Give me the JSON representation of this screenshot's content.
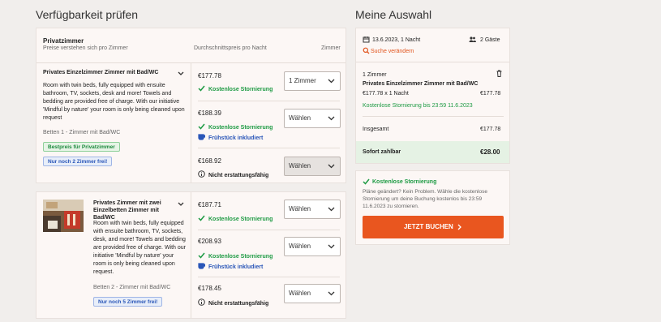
{
  "availability": {
    "heading": "Verfügbarkeit prüfen",
    "columns": {
      "room": "Privatzimmer",
      "room_sub": "Preise verstehen sich pro Zimmer",
      "price": "Durchschnittspreis pro Nacht",
      "rooms": "Zimmer"
    },
    "rooms": [
      {
        "title": "Privates Einzelzimmer Zimmer mit Bad/WC",
        "description": "Room with twin beds, fully equipped with ensuite bathroom, TV, sockets, desk and more! Towels and bedding are provided free of charge. With our initiative 'Mindful by nature' your room is only being cleaned upon request",
        "beds": "Betten 1 - Zimmer mit Bad/WC",
        "badge_best": "Bestpreis für Privatzimmer",
        "badge_left": "Nur noch 2 Zimmer frei!",
        "rates": [
          {
            "price": "€177.78",
            "cancel": "Kostenlose Stornierung",
            "extra": "",
            "select": "1 Zimmer"
          },
          {
            "price": "€188.39",
            "cancel": "Kostenlose Stornierung",
            "extra": "Frühstück inkludiert",
            "select": "Wählen"
          },
          {
            "price": "€168.92",
            "cancel": "Nicht erstattungsfähig",
            "extra": "",
            "select": "Wählen"
          }
        ]
      },
      {
        "title": "Privates Zimmer mit zwei Einzelbetten Zimmer mit Bad/WC",
        "description": "Room with twin beds, fully equipped with ensuite bathroom, TV, sockets, desk, and more! Towels and bedding are provided free of charge. With our initiative 'Mindful by nature' your room is only being cleaned upon request.",
        "beds": "Betten 2 - Zimmer mit Bad/WC",
        "badge_left": "Nur noch 5 Zimmer frei!",
        "rates": [
          {
            "price": "€187.71",
            "cancel": "Kostenlose Stornierung",
            "extra": "",
            "select": "Wählen"
          },
          {
            "price": "€208.93",
            "cancel": "Kostenlose Stornierung",
            "extra": "Frühstück inkludiert",
            "select": "Wählen"
          },
          {
            "price": "€178.45",
            "cancel": "Nicht erstattungsfähig",
            "extra": "",
            "select": "Wählen"
          }
        ]
      }
    ]
  },
  "selection": {
    "heading": "Meine Auswahl",
    "date": "13.6.2023, 1 Nacht",
    "guests": "2 Gäste",
    "change_search": "Suche verändern",
    "count": "1 Zimmer",
    "room_title": "Privates Einzelzimmer Zimmer mit Bad/WC",
    "line_price": "€177.78 x 1 Nacht",
    "line_total": "€177.78",
    "cancel_until": "Kostenlose Stornierung bis 23:59 11.6.2023",
    "total_label": "Insgesamt",
    "total_value": "€177.78",
    "pay_label": "Sofort zahlbar",
    "pay_value": "€28.00",
    "info_title": "Kostenlose Stornierung",
    "info_text": "Pläne geändert? Kein Problem. Wähle die kostenlose Stornierung um deine Buchung kostenlos bis 23:59 11.6.2023 zu stornieren.",
    "book_button": "JETZT BUCHEN"
  },
  "colors": {
    "accent": "#e9561f",
    "green": "#1d9a43",
    "blue": "#2a56b8"
  }
}
